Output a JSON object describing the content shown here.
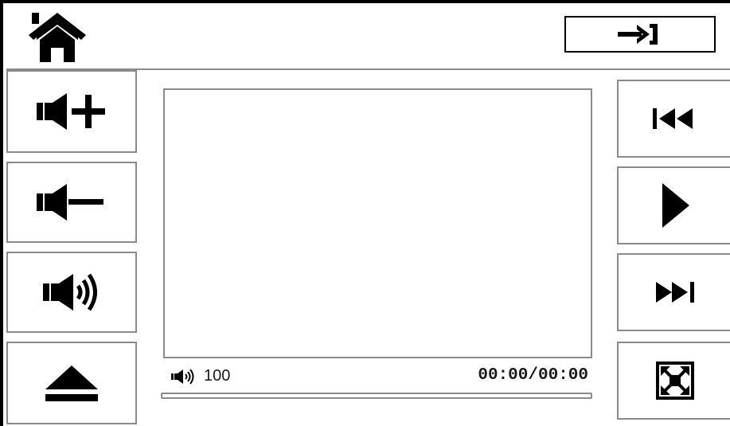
{
  "header": {
    "home_icon": "home-icon",
    "exit_icon": "exit-arrow-icon"
  },
  "left_controls": [
    {
      "name": "volume-up",
      "icon": "speaker-plus-icon"
    },
    {
      "name": "volume-down",
      "icon": "speaker-minus-icon"
    },
    {
      "name": "mute",
      "icon": "speaker-sound-icon"
    },
    {
      "name": "eject",
      "icon": "eject-icon"
    }
  ],
  "right_controls": [
    {
      "name": "previous-track",
      "icon": "skip-back-icon"
    },
    {
      "name": "play",
      "icon": "play-icon"
    },
    {
      "name": "next-track",
      "icon": "skip-forward-icon"
    },
    {
      "name": "fullscreen",
      "icon": "fullscreen-icon"
    }
  ],
  "player": {
    "volume_icon": "speaker-sound-icon",
    "volume": "100",
    "time": "00:00/00:00",
    "progress": 0
  },
  "colors": {
    "border": "#8a8a8a",
    "icon": "#000000",
    "background": "#ffffff"
  }
}
